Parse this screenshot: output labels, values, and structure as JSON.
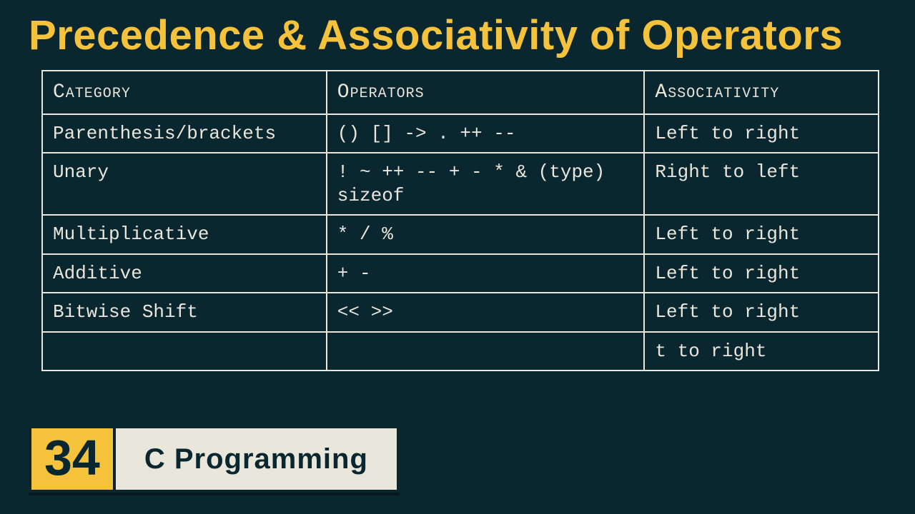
{
  "title": "Precedence & Associativity of Operators",
  "table": {
    "headers": [
      "Category",
      "Operators",
      "Associativity"
    ],
    "rows": [
      {
        "category": "Parenthesis/brackets",
        "operators": "() [] -> . ++ --",
        "assoc": "Left to right"
      },
      {
        "category": "Unary",
        "operators": "! ~ ++ -- + - * & (type) sizeof",
        "assoc": "Right to left"
      },
      {
        "category": "Multiplicative",
        "operators": "* / %",
        "assoc": "Left to right"
      },
      {
        "category": "Additive",
        "operators": "+ -",
        "assoc": "Left to right"
      },
      {
        "category": "Bitwise Shift",
        "operators": "<< >>",
        "assoc": "Left to right"
      },
      {
        "category": "",
        "operators": "",
        "assoc": "t to right"
      }
    ]
  },
  "badge": {
    "number": "34",
    "label": "C Programming"
  }
}
